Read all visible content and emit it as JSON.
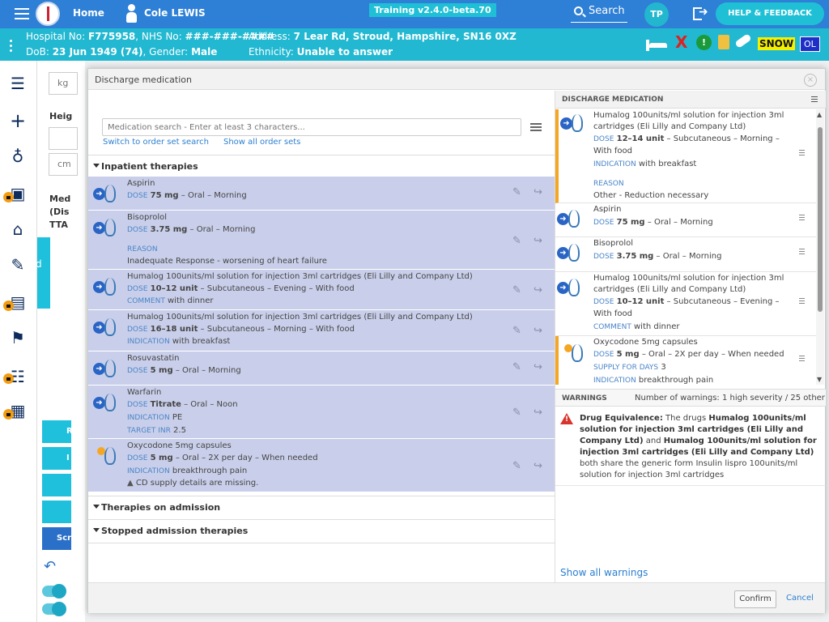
{
  "topbar": {
    "home_label": "Home",
    "patient_name": "Cole LEWIS",
    "version": "Training v2.4.0-beta.70",
    "search_label": "Search",
    "user_initials": "TP",
    "help_label": "HELP & FEEDBACK"
  },
  "banner": {
    "hospital_no_label": "Hospital No:",
    "hospital_no": "F775958",
    "nhs_no_label": ", NHS No:",
    "nhs_no": "###-###-####",
    "address_label": "Address:",
    "address": "7 Lear Rd, Stroud, Hampshire, SN16 0XZ",
    "dob_label": "DoB:",
    "dob": "23 Jun 1949 (74)",
    "gender_label": ", Gender:",
    "gender": "Male",
    "ethnicity_label": "Ethnicity:",
    "ethnicity": "Unable to answer",
    "flag_x": "X",
    "flag_alert": "!",
    "snow": "SNOW",
    "ol": "OL"
  },
  "bgpage": {
    "kg": "kg",
    "heig": "Heig",
    "cm": "cm",
    "med": "Med",
    "dis": "(Dis",
    "tta": "TTA",
    "d": "d",
    "r": "R",
    "i": "I",
    "scre": "Scre"
  },
  "modal": {
    "title": "Discharge medication",
    "close": "×",
    "search_placeholder": "Medication search - Enter at least 3 characters...",
    "switch_link": "Switch to order set search",
    "show_all_link": "Show all order sets",
    "sections": {
      "inpatient": "Inpatient therapies",
      "admission": "Therapies on admission",
      "stopped": "Stopped admission therapies"
    },
    "confirm": "Confirm",
    "cancel": "Cancel"
  },
  "inpatient_rows": [
    {
      "name": "Aspirin",
      "l1_lab": "DOSE",
      "l1_val": "75 mg",
      "l1_rest": " – Oral – Morning"
    },
    {
      "name": "Bisoprolol",
      "l1_lab": "DOSE",
      "l1_val": "3.75 mg",
      "l1_rest": " – Oral – Morning",
      "l2_lab": "REASON",
      "l3": "Inadequate Response - worsening of heart failure"
    },
    {
      "name": "Humalog 100units/ml solution for injection 3ml cartridges (Eli Lilly and Company Ltd)",
      "l1_lab": "DOSE",
      "l1_val": "10–12 unit",
      "l1_rest": " – Subcutaneous – Evening – With food",
      "l2_lab": "COMMENT",
      "l2_rest": " with dinner"
    },
    {
      "name": "Humalog 100units/ml solution for injection 3ml cartridges (Eli Lilly and Company Ltd)",
      "l1_lab": "DOSE",
      "l1_val": "16–18 unit",
      "l1_rest": " – Subcutaneous – Morning – With food",
      "l2_lab": "INDICATION",
      "l2_rest": " with breakfast"
    },
    {
      "name": "Rosuvastatin",
      "l1_lab": "DOSE",
      "l1_val": "5 mg",
      "l1_rest": " – Oral – Morning"
    },
    {
      "name": "Warfarin",
      "l1_lab": "DOSE",
      "l1_val": "Titrate",
      "l1_rest": " – Oral – Noon",
      "l2_lab": "INDICATION",
      "l2_rest": " PE",
      "l3_lab": "TARGET INR",
      "l3_rest": " 2.5"
    },
    {
      "name": "Oxycodone 5mg capsules",
      "l1_lab": "DOSE",
      "l1_val": "5 mg",
      "l1_rest": " – Oral – 2X per day – When needed",
      "l2_lab": "INDICATION",
      "l2_rest": " breakthrough pain",
      "l3": "CD supply details are missing."
    }
  ],
  "discharge": {
    "header": "DISCHARGE MEDICATION",
    "rows": [
      {
        "name1": "Humalog 100units/ml solution for injection 3ml",
        "name2": "cartridges (Eli Lilly and Company Ltd)",
        "dose_lab": "DOSE",
        "dose_val": "12–14 unit",
        "dose_rest": " – Subcutaneous – Morning –",
        "dose_rest2": "With food",
        "x_lab": "INDICATION",
        "x_rest": " with breakfast",
        "r_lab": "REASON",
        "r_text": "Other - Reduction necessary"
      },
      {
        "name1": "Aspirin",
        "dose_lab": "DOSE",
        "dose_val": "75 mg",
        "dose_rest": " – Oral – Morning"
      },
      {
        "name1": "Bisoprolol",
        "dose_lab": "DOSE",
        "dose_val": "3.75 mg",
        "dose_rest": " – Oral – Morning"
      },
      {
        "name1": "Humalog 100units/ml solution for injection 3ml",
        "name2": "cartridges (Eli Lilly and Company Ltd)",
        "dose_lab": "DOSE",
        "dose_val": "10–12 unit",
        "dose_rest": " – Subcutaneous – Evening –",
        "dose_rest2": "With food",
        "x_lab": "COMMENT",
        "x_rest": " with dinner"
      },
      {
        "name1": "Oxycodone 5mg capsules",
        "dose_lab": "DOSE",
        "dose_val": "5 mg",
        "dose_rest": " – Oral – 2X per day – When needed",
        "s_lab": "SUPPLY FOR DAYS",
        "s_rest": " 3",
        "x_lab": "INDICATION",
        "x_rest": " breakthrough pain"
      }
    ]
  },
  "warnings": {
    "header": "WARNINGS",
    "count": "Number of warnings: 1 high severity / 25 other",
    "title": "Drug Equivalence:",
    "t1": " The drugs ",
    "drug1": "Humalog 100units/ml solution for injection 3ml cartridges (Eli Lilly and Company Ltd)",
    "t2": " and ",
    "drug2": "Humalog 100units/ml solution for injection 3ml cartridges (Eli Lilly and Company Ltd)",
    "t3": " both share the generic form Insulin lispro 100units/ml solution for injection 3ml cartridges",
    "show_all": "Show all warnings"
  }
}
